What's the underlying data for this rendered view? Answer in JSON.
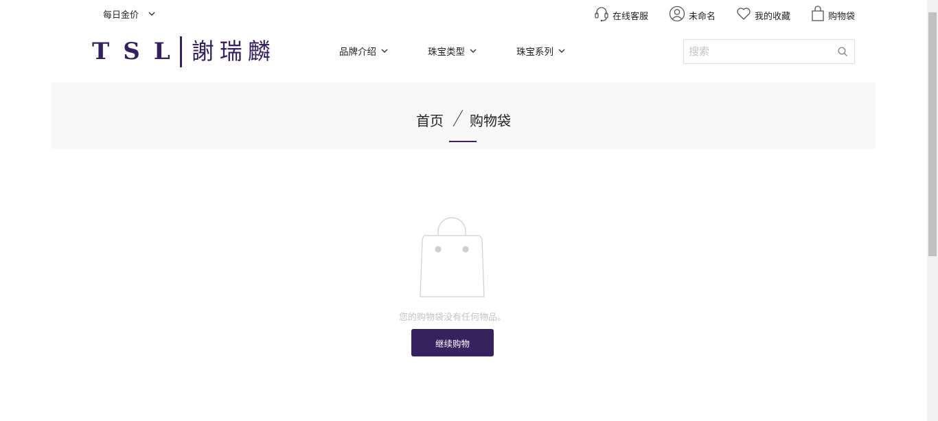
{
  "topbar": {
    "gold_price_label": "每日金价",
    "links": {
      "service": "在线客服",
      "account": "未命名",
      "favorites": "我的收藏",
      "bag": "购物袋"
    }
  },
  "logo": {
    "latin": "TSL",
    "chinese": "謝瑞麟"
  },
  "nav": {
    "brand": "品牌介绍",
    "jewelry_type": "珠宝类型",
    "series": "珠宝系列"
  },
  "search": {
    "placeholder": "搜索",
    "value": ""
  },
  "breadcrumb": {
    "home": "首页",
    "current": "购物袋"
  },
  "empty_state": {
    "message": "您的购物袋没有任何物品。",
    "button_label": "继续购物"
  },
  "colors": {
    "brand": "#34205e",
    "button_bg": "#36225f",
    "band_bg": "#f8f8f8",
    "muted_text": "#c4c4c4"
  },
  "icons": {
    "gold_price_dropdown": "chevron-down-icon",
    "service": "headset-icon",
    "account": "user-icon",
    "favorites": "heart-icon",
    "bag": "shopping-bag-icon",
    "nav_dropdown": "chevron-down-icon",
    "search": "search-icon",
    "empty_bag": "empty-bag-illustration"
  }
}
